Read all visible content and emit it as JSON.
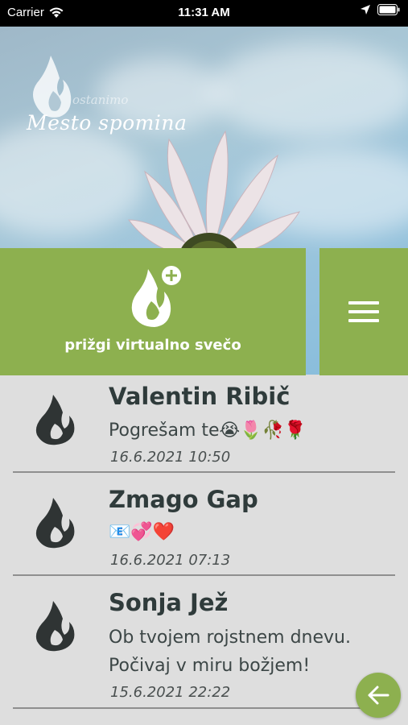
{
  "status_bar": {
    "carrier": "Carrier",
    "time": "11:31 AM"
  },
  "logo": {
    "subtitle": "ostanimo",
    "title": "Mesto spomina"
  },
  "candle_button": {
    "label": "prižgi virtualno svečo"
  },
  "entries": [
    {
      "name": "Valentin Ribič",
      "message": "Pogrešam te😭🌷🥀🌹",
      "date": "16.6.2021 10:50"
    },
    {
      "name": "Zmago Gap",
      "message": "📧💞❤️",
      "date": "16.6.2021 07:13"
    },
    {
      "name": "Sonja Jež",
      "message_line1": "Ob tvojem rojstnem dnevu.",
      "message_line2": "Počivaj v miru božjem!",
      "date": "15.6.2021 22:22"
    }
  ],
  "colors": {
    "accent": "#8db04f",
    "text_dark": "#2f3b3b",
    "background": "#dedede"
  },
  "icons": [
    "wifi-icon",
    "location-arrow-icon",
    "battery-icon",
    "flame-logo-icon",
    "add-candle-icon",
    "menu-icon",
    "flame-icon",
    "back-arrow-icon"
  ]
}
